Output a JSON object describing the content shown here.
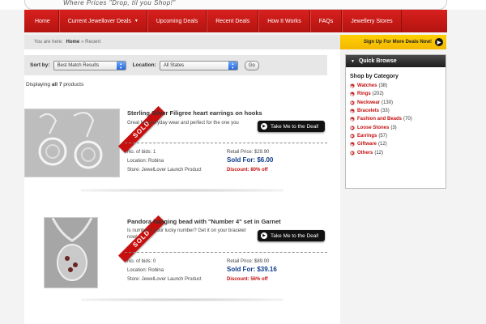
{
  "header": {
    "tagline": "Where Prices \"Drop, til you Shop!\""
  },
  "nav": {
    "items": [
      "Home",
      "Current Jewellover Deals",
      "Upcoming Deals",
      "Recent Deals",
      "How It Works",
      "FAQs",
      "Jewellery Stores"
    ],
    "dropdown_caret": "▼"
  },
  "breadcrumb": {
    "prefix": "You are here:",
    "home": "Home",
    "sep": "»",
    "current": "Recent"
  },
  "signup": {
    "label": "Sign Up For More Deals Now!",
    "icon": "arrow-right-circle-icon"
  },
  "sort": {
    "sort_label": "Sort by:",
    "sort_value": "Best Match Results",
    "location_label": "Location:",
    "location_value": "All States",
    "go_label": "Go"
  },
  "listing": {
    "displaying_prefix": "Displaying ",
    "displaying_count": "all 7",
    "displaying_suffix": " products"
  },
  "products": [
    {
      "title": "Sterling Silver Filigree heart earrings on hooks",
      "description": "Great for everyday wear and perfect for the one you",
      "sold_badge": "SOLD",
      "deal_button": "Take Me to the Deal!",
      "bids": "No. of bids: 1",
      "location": "Location: Robina",
      "store": "Store: JewelLover Launch Product",
      "retail": "Retail Price: $29.90",
      "sold_for": "Sold For: $6.00",
      "discount": "Discount: 80% off"
    },
    {
      "title": "Pandora hanging bead with \"Number 4\" set in Garnet",
      "description": "Is number 4 your lucky number? Get it on your bracelet now!",
      "sold_badge": "SOLD",
      "deal_button": "Take Me to the Deal!",
      "bids": "No. of bids: 0",
      "location": "Location: Robina",
      "store": "Store: JewelLover Launch Product",
      "retail": "Retail Price: $89.00",
      "sold_for": "Sold For: $39.16",
      "discount": "Discount: 56% off"
    }
  ],
  "sidebar": {
    "header": "Quick Browse",
    "category_title": "Shop by Category",
    "categories": [
      {
        "name": "Watches",
        "count": "(38)"
      },
      {
        "name": "Rings",
        "count": "(202)"
      },
      {
        "name": "Neckwear",
        "count": "(130)"
      },
      {
        "name": "Bracelets",
        "count": "(33)"
      },
      {
        "name": "Fashion and Beads",
        "count": "(70)"
      },
      {
        "name": "Loose Stones",
        "count": "(3)"
      },
      {
        "name": "Earrings",
        "count": "(57)"
      },
      {
        "name": "Giftware",
        "count": "(12)"
      },
      {
        "name": "Others",
        "count": "(12)"
      }
    ]
  },
  "colors": {
    "nav_red": "#c8181a",
    "accent_yellow": "#f7c200",
    "price_blue": "#0f3c8a",
    "discount_red": "#c41010"
  }
}
